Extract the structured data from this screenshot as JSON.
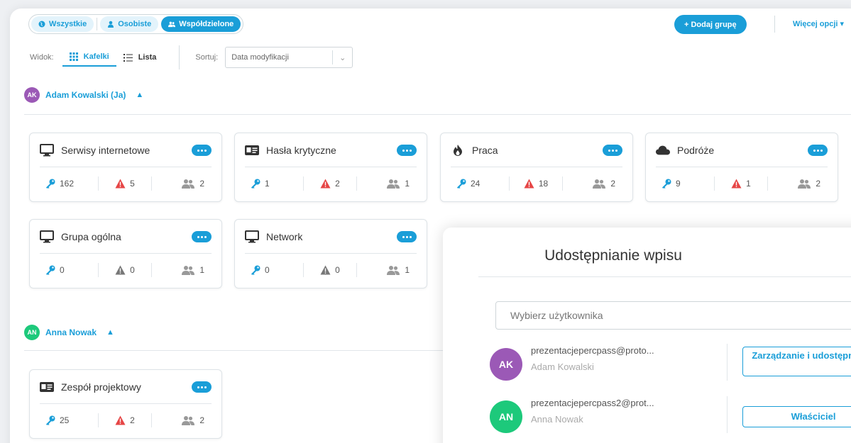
{
  "colors": {
    "accent": "#1a9ed8",
    "danger": "#e64545",
    "neutral": "#777777",
    "avatar_ak": "#9b59b6",
    "avatar_an": "#1dc97b"
  },
  "filters": [
    {
      "label": "Wszystkie",
      "icon": "globe-icon",
      "active": false
    },
    {
      "label": "Osobiste",
      "icon": "user-icon",
      "active": false
    },
    {
      "label": "Współdzielone",
      "icon": "users-icon",
      "active": true
    }
  ],
  "toolbar": {
    "add_label": "+ Dodaj grupę",
    "more_label": "Więcej opcji"
  },
  "view": {
    "label": "Widok:",
    "tiles": "Kafelki",
    "list": "Lista",
    "sort_label": "Sortuj:",
    "sort_value": "Data modyfikacji"
  },
  "owners": [
    {
      "initials": "AK",
      "name": "Adam Kowalski (Ja)"
    },
    {
      "initials": "AN",
      "name": "Anna Nowak"
    }
  ],
  "groups": [
    {
      "title": "Serwisy internetowe",
      "icon": "monitor-icon",
      "keys": "162",
      "alerts": "5",
      "users": "2",
      "alert_active": true
    },
    {
      "title": "Hasła krytyczne",
      "icon": "id-card-icon",
      "keys": "1",
      "alerts": "2",
      "users": "1",
      "alert_active": true
    },
    {
      "title": "Praca",
      "icon": "fire-icon",
      "keys": "24",
      "alerts": "18",
      "users": "2",
      "alert_active": true
    },
    {
      "title": "Podróże",
      "icon": "cloud-icon",
      "keys": "9",
      "alerts": "1",
      "users": "2",
      "alert_active": true
    },
    {
      "title": "Grupa ogólna",
      "icon": "monitor-icon",
      "keys": "0",
      "alerts": "0",
      "users": "1",
      "alert_active": false
    },
    {
      "title": "Network",
      "icon": "monitor-icon",
      "keys": "0",
      "alerts": "0",
      "users": "1",
      "alert_active": false
    },
    {
      "title": "Zespół projektowy",
      "icon": "id-card-icon",
      "keys": "25",
      "alerts": "2",
      "users": "2",
      "alert_active": true
    }
  ],
  "share": {
    "title": "Udostępnianie wpisu",
    "input_placeholder": "Wybierz użytkownika",
    "users": [
      {
        "initials": "AK",
        "email": "prezentacjepercpass@proto...",
        "name": "Adam Kowalski",
        "role": "Zarządzanie i udostępnianie"
      },
      {
        "initials": "AN",
        "email": "prezentacjepercpass2@prot...",
        "name": "Anna Nowak",
        "role": "Właściciel"
      }
    ]
  }
}
